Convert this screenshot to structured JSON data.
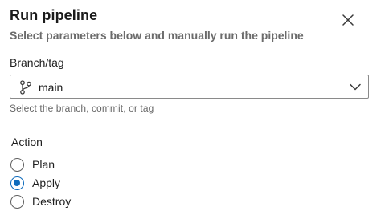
{
  "dialog": {
    "title": "Run pipeline",
    "subtitle": "Select parameters below and manually run the pipeline",
    "close_icon": "close-icon"
  },
  "branch_field": {
    "label": "Branch/tag",
    "value": "main",
    "icon": "git-branch-icon",
    "helper": "Select the branch, commit, or tag"
  },
  "action": {
    "label": "Action",
    "selected": "Apply",
    "options": [
      {
        "label": "Plan",
        "checked": false
      },
      {
        "label": "Apply",
        "checked": true
      },
      {
        "label": "Destroy",
        "checked": false
      }
    ]
  },
  "colors": {
    "accent": "#0f6cbd",
    "subtitle": "#6b6b6b",
    "helper": "#666666",
    "border": "#8a8a8a"
  }
}
